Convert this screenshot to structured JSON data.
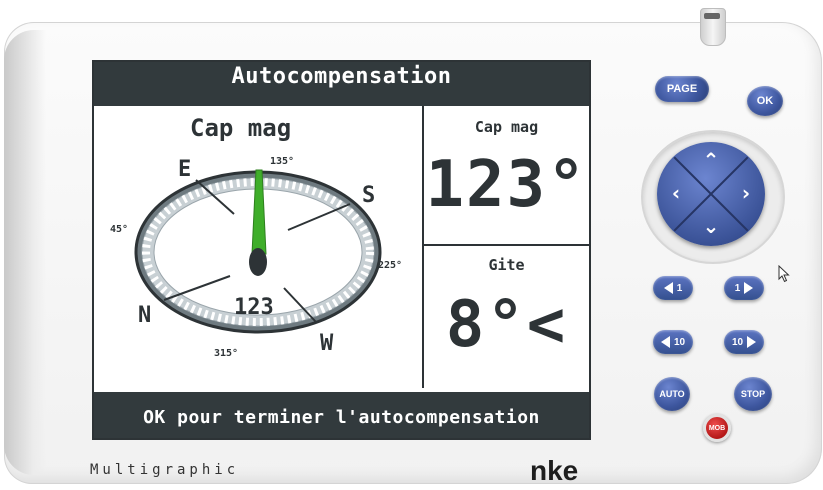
{
  "device": {
    "brand_left": "Multigraphic",
    "brand_right": "nke"
  },
  "screen": {
    "header": "Autocompensation",
    "footer": "OK pour terminer l'autocompensation",
    "compass": {
      "title": "Cap mag",
      "value": "123",
      "labels": {
        "E": "E",
        "S": "S",
        "N": "N",
        "W": "W"
      },
      "degree_labels": [
        "135°",
        "45°",
        "225°",
        "315°"
      ]
    },
    "cap_mag": {
      "label": "Cap mag",
      "value": "123°"
    },
    "gite": {
      "label": "Gite",
      "value": "8°<"
    }
  },
  "buttons": {
    "page": "PAGE",
    "ok": "OK",
    "up": "⌃",
    "down": "⌄",
    "left": "‹",
    "right": "›",
    "minus1": "1",
    "plus1": "1",
    "minus10": "10",
    "plus10": "10",
    "auto": "AUTO",
    "stop": "STOP",
    "mob": "MOB"
  },
  "colors": {
    "screen_dark": "#323a3d",
    "button_blue": "#3d569e",
    "needle_green": "#3fae2a",
    "mob_red": "#c81e1e"
  }
}
